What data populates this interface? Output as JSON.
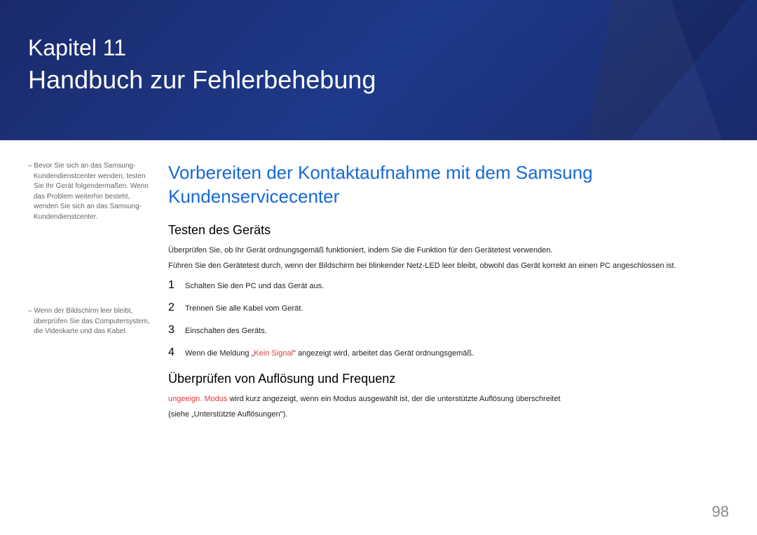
{
  "header": {
    "chapter_label": "Kapitel 11",
    "chapter_title": "Handbuch zur Fehlerbehebung"
  },
  "sidebar": {
    "note1": "Bevor Sie sich an das Samsung-Kundendienstcenter wenden, testen Sie Ihr Gerät folgendermaßen. Wenn das Problem weiterhin besteht, wenden Sie sich an das Samsung-Kundendienstcenter.",
    "note2": "Wenn der Bildschirm leer bleibt, überprüfen Sie das Computersystem, die Videokarte und das Kabel."
  },
  "main": {
    "section_heading": "Vorbereiten der Kontaktaufnahme mit dem Samsung Kundenservicecenter",
    "sub1_heading": "Testen des Geräts",
    "para1": "Überprüfen Sie, ob Ihr Gerät ordnungsgemäß funktioniert, indem Sie die Funktion für den Gerätetest verwenden.",
    "para2": "Führen Sie den Gerätetest durch, wenn der Bildschirm bei blinkender Netz-LED leer bleibt, obwohl das Gerät korrekt an einen PC angeschlossen ist.",
    "steps": [
      {
        "num": "1",
        "text": "Schalten Sie den PC und das Gerät aus."
      },
      {
        "num": "2",
        "text": "Trennen Sie alle Kabel vom Gerät."
      },
      {
        "num": "3",
        "text": "Einschalten des Geräts."
      },
      {
        "num": "4",
        "pre": "Wenn die Meldung „",
        "red": "Kein Signal",
        "post": "\" angezeigt wird, arbeitet das Gerät ordnungsgemäß."
      }
    ],
    "sub2_heading": "Überprüfen von Auflösung und Frequenz",
    "para3_red": "ungeeign. Modus",
    "para3_rest": " wird kurz angezeigt, wenn ein Modus ausgewählt ist, der die unterstützte Auflösung überschreitet",
    "para4": "(siehe „Unterstützte Auflösungen\")."
  },
  "page_number": "98"
}
